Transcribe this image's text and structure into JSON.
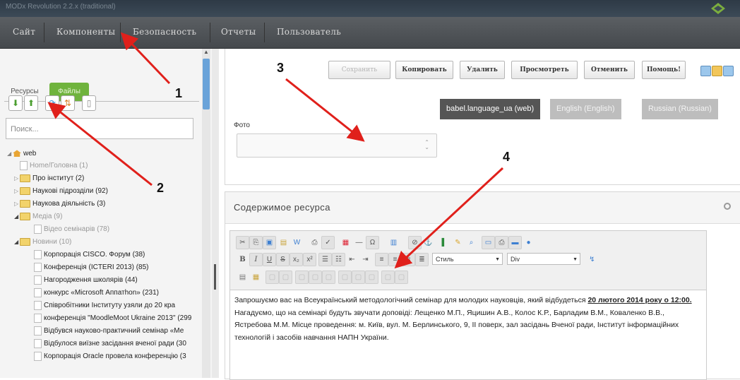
{
  "window": {
    "title": "MODx Revolution 2.2.x (traditional)"
  },
  "menu": {
    "items": [
      "Сайт",
      "Компоненты",
      "Безопасность",
      "Отчеты",
      "Пользователь"
    ]
  },
  "leftpanel": {
    "tabs": [
      "Ресурсы",
      "Файлы"
    ],
    "search_placeholder": "Поиск...",
    "tree": [
      {
        "label": "web",
        "level": 0,
        "kind": "root"
      },
      {
        "label": "Home/Головна (1)",
        "level": 1,
        "kind": "page",
        "muted": true
      },
      {
        "label": "Про інститут (2)",
        "level": 1,
        "kind": "folder"
      },
      {
        "label": "Наукові підрозділи (92)",
        "level": 1,
        "kind": "folder"
      },
      {
        "label": "Наукова діяльність (3)",
        "level": 1,
        "kind": "folder"
      },
      {
        "label": "Медіа (9)",
        "level": 1,
        "kind": "folder",
        "muted": true,
        "open": true
      },
      {
        "label": "Відео семінарів (78)",
        "level": 2,
        "kind": "page",
        "muted": true
      },
      {
        "label": "Новини (10)",
        "level": 1,
        "kind": "folder",
        "muted": true,
        "open": true
      },
      {
        "label": "Корпорація CISCO. Форум (38)",
        "level": 2,
        "kind": "page"
      },
      {
        "label": "Конференція (ICTERI 2013) (85)",
        "level": 2,
        "kind": "page"
      },
      {
        "label": "Нагородження школярів (44)",
        "level": 2,
        "kind": "page"
      },
      {
        "label": "конкурс «Microsoft Аппатhon» (231)",
        "level": 2,
        "kind": "page"
      },
      {
        "label": "Співробітники Інституту узяли до 20 кра",
        "level": 2,
        "kind": "page"
      },
      {
        "label": "конференція \"MoodleMoot Ukraine 2013\" (299",
        "level": 2,
        "kind": "page"
      },
      {
        "label": "Відбувся науково-практичний семінар «Ме",
        "level": 2,
        "kind": "page"
      },
      {
        "label": "Відбулося виїзне засідання вченої ради (30",
        "level": 2,
        "kind": "page"
      },
      {
        "label": "Корпорація Oracle провела конференцію (3",
        "level": 2,
        "kind": "page"
      }
    ]
  },
  "toolbar": {
    "save": "Сохранить",
    "copy": "Копировать",
    "delete": "Удалить",
    "view": "Просмотреть",
    "cancel": "Отменить",
    "help": "Помощь!"
  },
  "languages": [
    "babel.language_ua (web)",
    "English (English)",
    "Russian (Russian)"
  ],
  "foto": {
    "label": "Фото"
  },
  "content": {
    "title": "Содержимое ресурса",
    "style_select": "Стиль",
    "format_select": "Div",
    "text": {
      "p1": "Запрошуємо вас на Всеукраїнський методологічний семінар для молодих науковців, який відбудеться ",
      "p1_bold": "20 лютого 2014 року о 12:00.",
      "p2": "Нагадуємо, що на семінарі будуть звучати доповіді: Лещенко М.П., Яцишин А.В., Колос К.Р., Барладим В.М., Коваленко В.В.,",
      "p3": "Ястребова М.М. Місце проведення: м. Київ, вул. М. Берлинського, 9, ІІ поверх, зал засідань Вченої ради, Інститут інформаційних технологій і засобів навчання НАПН України."
    }
  },
  "annotations": [
    "1",
    "2",
    "3",
    "4"
  ],
  "colors": {
    "accent_green": "#6fb33d",
    "arrow_red": "#e0201b",
    "menubar": "#4e5256"
  }
}
